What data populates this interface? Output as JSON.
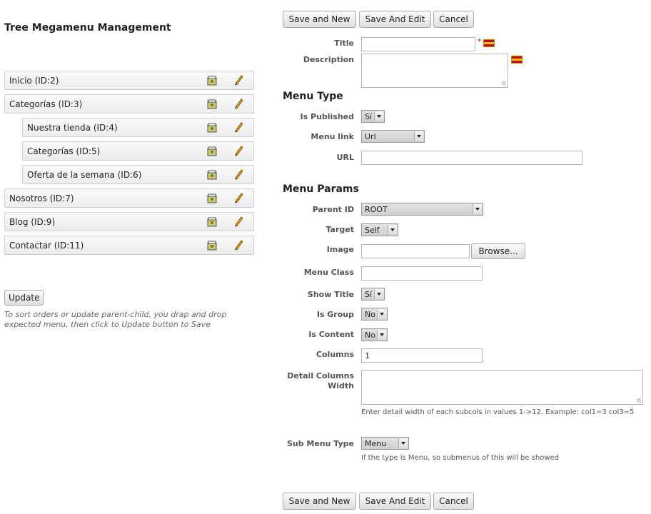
{
  "left": {
    "title": "Tree Megamenu Management",
    "tree": [
      {
        "label": "Inicio (ID:2)",
        "level": 0
      },
      {
        "label": "Categorías (ID:3)",
        "level": 0
      },
      {
        "label": "Nuestra tienda (ID:4)",
        "level": 1
      },
      {
        "label": "Categorías (ID:5)",
        "level": 1
      },
      {
        "label": "Oferta de la semana (ID:6)",
        "level": 1
      },
      {
        "label": "Nosotros (ID:7)",
        "level": 0
      },
      {
        "label": "Blog (ID:9)",
        "level": 0
      },
      {
        "label": "Contactar (ID:11)",
        "level": 0
      }
    ],
    "update_label": "Update",
    "hint_line1": "To sort orders or update parent-child, you drap and drop",
    "hint_line2": "expected menu, then click to Update button to Save"
  },
  "actions": {
    "save_new": "Save and New",
    "save_edit": "Save And Edit",
    "cancel": "Cancel"
  },
  "form": {
    "title_label": "Title",
    "title_value": "",
    "required_mark": "*",
    "description_label": "Description",
    "menu_type_heading": "Menu Type",
    "is_published_label": "Is Published",
    "is_published_value": "Sí",
    "menu_link_label": "Menu link",
    "menu_link_value": "Url",
    "url_label": "URL",
    "url_value": "",
    "menu_params_heading": "Menu Params",
    "parent_id_label": "Parent ID",
    "parent_id_value": "ROOT",
    "target_label": "Target",
    "target_value": "Self",
    "image_label": "Image",
    "browse_label": "Browse...",
    "menu_class_label": "Menu Class",
    "menu_class_value": "",
    "show_title_label": "Show Title",
    "show_title_value": "Sí",
    "is_group_label": "Is Group",
    "is_group_value": "No",
    "is_content_label": "Is Content",
    "is_content_value": "No",
    "columns_label": "Columns",
    "columns_value": "1",
    "detail_columns_label_1": "Detail Columns",
    "detail_columns_label_2": "Width",
    "detail_columns_help": "Enter detail width of each subcols in values 1->12. Example: col1=3 col3=5",
    "sub_menu_type_label": "Sub Menu Type",
    "sub_menu_type_value": "Menu",
    "sub_menu_type_help": "If the type is Menu, so submenus of this will be showed"
  },
  "colors": {
    "flag_red": "#c60b1e",
    "flag_yellow": "#ffc400",
    "required": "#cc0000"
  },
  "icons": {
    "manage": "folder-manage-icon",
    "edit": "pencil-icon",
    "language": "flag-es-icon"
  }
}
